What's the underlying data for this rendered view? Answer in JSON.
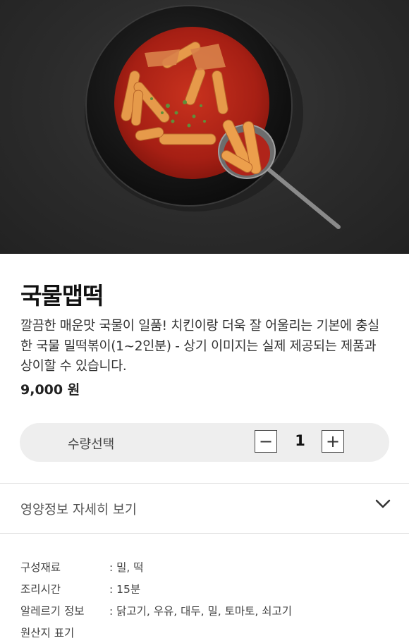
{
  "hero": {
    "image_alt": "국물맵떡 bowl photo",
    "share_icon": "share-icon"
  },
  "product": {
    "name": "국물맵떡",
    "description": "깔끔한 매운맛 국물이 일품! 치킨이랑 더욱 잘 어울리는 기본에 충실한 국물 밀떡볶이(1~2인분) - 상기 이미지는 실제 제공되는 제품과 상이할 수 있습니다.",
    "price": "9,000 원"
  },
  "quantity": {
    "label": "수량선택",
    "minus": "−",
    "value": "1",
    "plus": "+"
  },
  "nutrition": {
    "label": "영양정보 자세히 보기",
    "icon": "chevron-down-icon"
  },
  "info": [
    {
      "key": "구성재료",
      "value": ": 밀, 떡"
    },
    {
      "key": "조리시간",
      "value": ": 15분"
    },
    {
      "key": "알레르기 정보",
      "value": ": 닭고기, 우유, 대두, 밀, 토마토, 쇠고기"
    },
    {
      "key": "원산지 표기",
      "value": ""
    }
  ],
  "colors": {
    "background": "#ffffff",
    "pill": "#eeeeee",
    "sauce": "#b8281a",
    "bowl": "#151515"
  }
}
